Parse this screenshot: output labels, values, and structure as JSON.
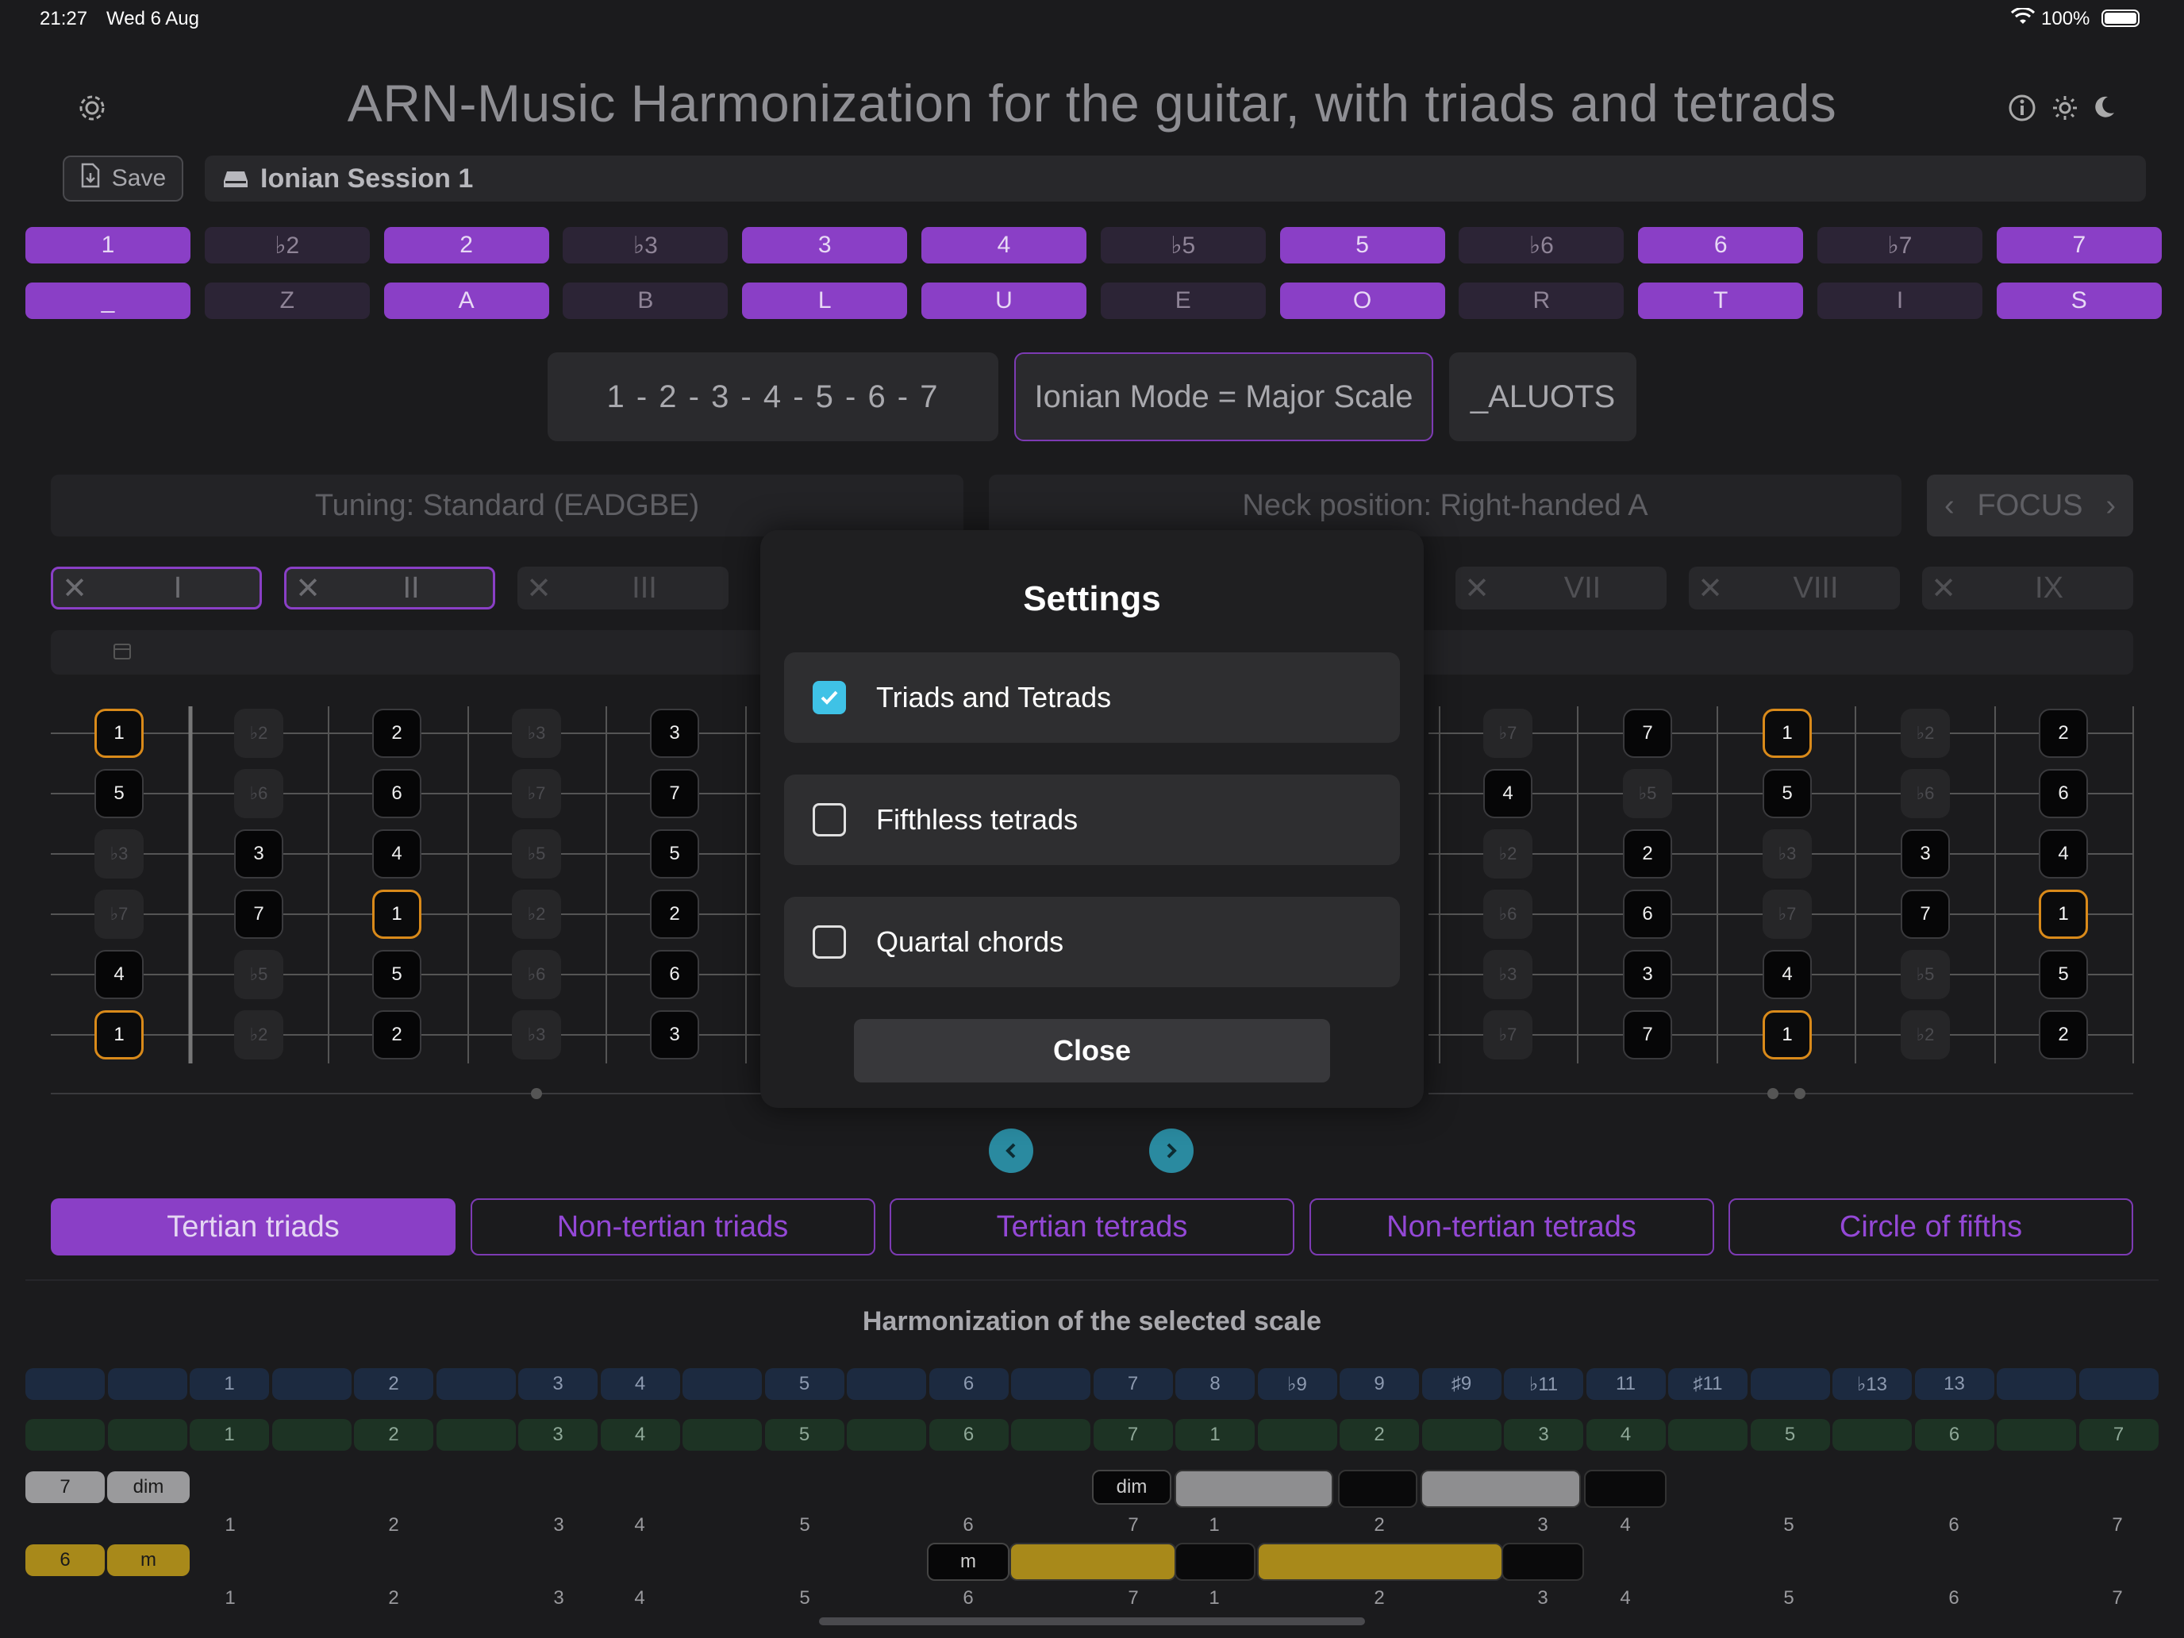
{
  "status": {
    "time": "21:27",
    "date": "Wed 6 Aug",
    "battery": "100%"
  },
  "app": {
    "title": "ARN-Music   Harmonization for the guitar, with triads and tetrads"
  },
  "toolbar": {
    "save_label": "Save",
    "session_name": "Ionian Session 1"
  },
  "degrees": [
    {
      "label": "1",
      "on": true
    },
    {
      "label": "♭2",
      "on": false
    },
    {
      "label": "2",
      "on": true
    },
    {
      "label": "♭3",
      "on": false
    },
    {
      "label": "3",
      "on": true
    },
    {
      "label": "4",
      "on": true
    },
    {
      "label": "♭5",
      "on": false
    },
    {
      "label": "5",
      "on": true
    },
    {
      "label": "♭6",
      "on": false
    },
    {
      "label": "6",
      "on": true
    },
    {
      "label": "♭7",
      "on": false
    },
    {
      "label": "7",
      "on": true
    }
  ],
  "letters": [
    "_",
    "Z",
    "A",
    "B",
    "L",
    "U",
    "E",
    "O",
    "R",
    "T",
    "I",
    "S"
  ],
  "scale": {
    "formula": "1 - 2 - 3 - 4 - 5 - 6 - 7",
    "name": "Ionian Mode = Major Scale",
    "code": "_ALUOTS"
  },
  "tuning_label": "Tuning: Standard (EADGBE)",
  "neck_label": "Neck position: Right-handed A",
  "focus_label": "FOCUS",
  "positions": [
    {
      "label": "I",
      "active": true
    },
    {
      "label": "II",
      "active": true
    },
    {
      "label": "III",
      "active": false
    },
    {
      "label": "VII",
      "active": false
    },
    {
      "label": "VIII",
      "active": false
    },
    {
      "label": "IX",
      "active": false
    }
  ],
  "fretboard_left": [
    [
      "1",
      "5",
      "♭3",
      "♭7",
      "4",
      "1"
    ],
    [
      "♭2",
      "♭6",
      "3",
      "7",
      "♭5",
      "♭2"
    ],
    [
      "2",
      "6",
      "4",
      "1",
      "5",
      "2"
    ],
    [
      "♭3",
      "♭7",
      "♭5",
      "♭2",
      "♭6",
      "♭3"
    ],
    [
      "3",
      "7",
      "5",
      "2",
      "6",
      "3"
    ]
  ],
  "fretboard_right": [
    [
      "♭7",
      "4",
      "♭2",
      "♭6",
      "♭3",
      "♭7"
    ],
    [
      "7",
      "♭5",
      "2",
      "6",
      "3",
      "7"
    ],
    [
      "1",
      "5",
      "♭3",
      "♭7",
      "4",
      "1"
    ],
    [
      "♭2",
      "♭6",
      "3",
      "7",
      "♭5",
      "♭2"
    ],
    [
      "2",
      "6",
      "4",
      "1",
      "5",
      "2"
    ]
  ],
  "tabs": [
    {
      "label": "Tertian triads",
      "active": true
    },
    {
      "label": "Non-tertian triads",
      "active": false
    },
    {
      "label": "Tertian tetrads",
      "active": false
    },
    {
      "label": "Non-tertian tetrads",
      "active": false
    },
    {
      "label": "Circle of fifths",
      "active": false
    }
  ],
  "harmonization": {
    "title": "Harmonization of the selected scale",
    "row_blue": [
      "",
      "",
      "1",
      "",
      "2",
      "",
      "3",
      "4",
      "",
      "5",
      "",
      "6",
      "",
      "7",
      "8",
      "♭9",
      "9",
      "♯9",
      "♭11",
      "11",
      "♯11",
      "",
      "♭13",
      "13",
      "",
      ""
    ],
    "row_green": [
      "",
      "",
      "1",
      "",
      "2",
      "",
      "3",
      "4",
      "",
      "5",
      "",
      "6",
      "",
      "7",
      "1",
      "",
      "2",
      "",
      "3",
      "4",
      "",
      "5",
      "",
      "6",
      "",
      "7"
    ],
    "row_dim": {
      "degree": "7",
      "quality": "dim"
    },
    "row_m": {
      "degree": "6",
      "quality": "m"
    },
    "numbers_row": [
      "1",
      "2",
      "3",
      "4",
      "5",
      "6",
      "7",
      "1",
      "2",
      "3",
      "4",
      "5",
      "6",
      "7"
    ]
  },
  "modal": {
    "title": "Settings",
    "options": [
      {
        "label": "Triads and Tetrads",
        "checked": true
      },
      {
        "label": "Fifthless tetrads",
        "checked": false
      },
      {
        "label": "Quartal chords",
        "checked": false
      }
    ],
    "close_label": "Close"
  },
  "colors": {
    "accent": "#8a3fc6",
    "root_border": "#d98a1a",
    "checkbox": "#3fc2e6",
    "blue_row": "#1c2a40",
    "green_row": "#1d3324",
    "gold": "#a8891a"
  }
}
